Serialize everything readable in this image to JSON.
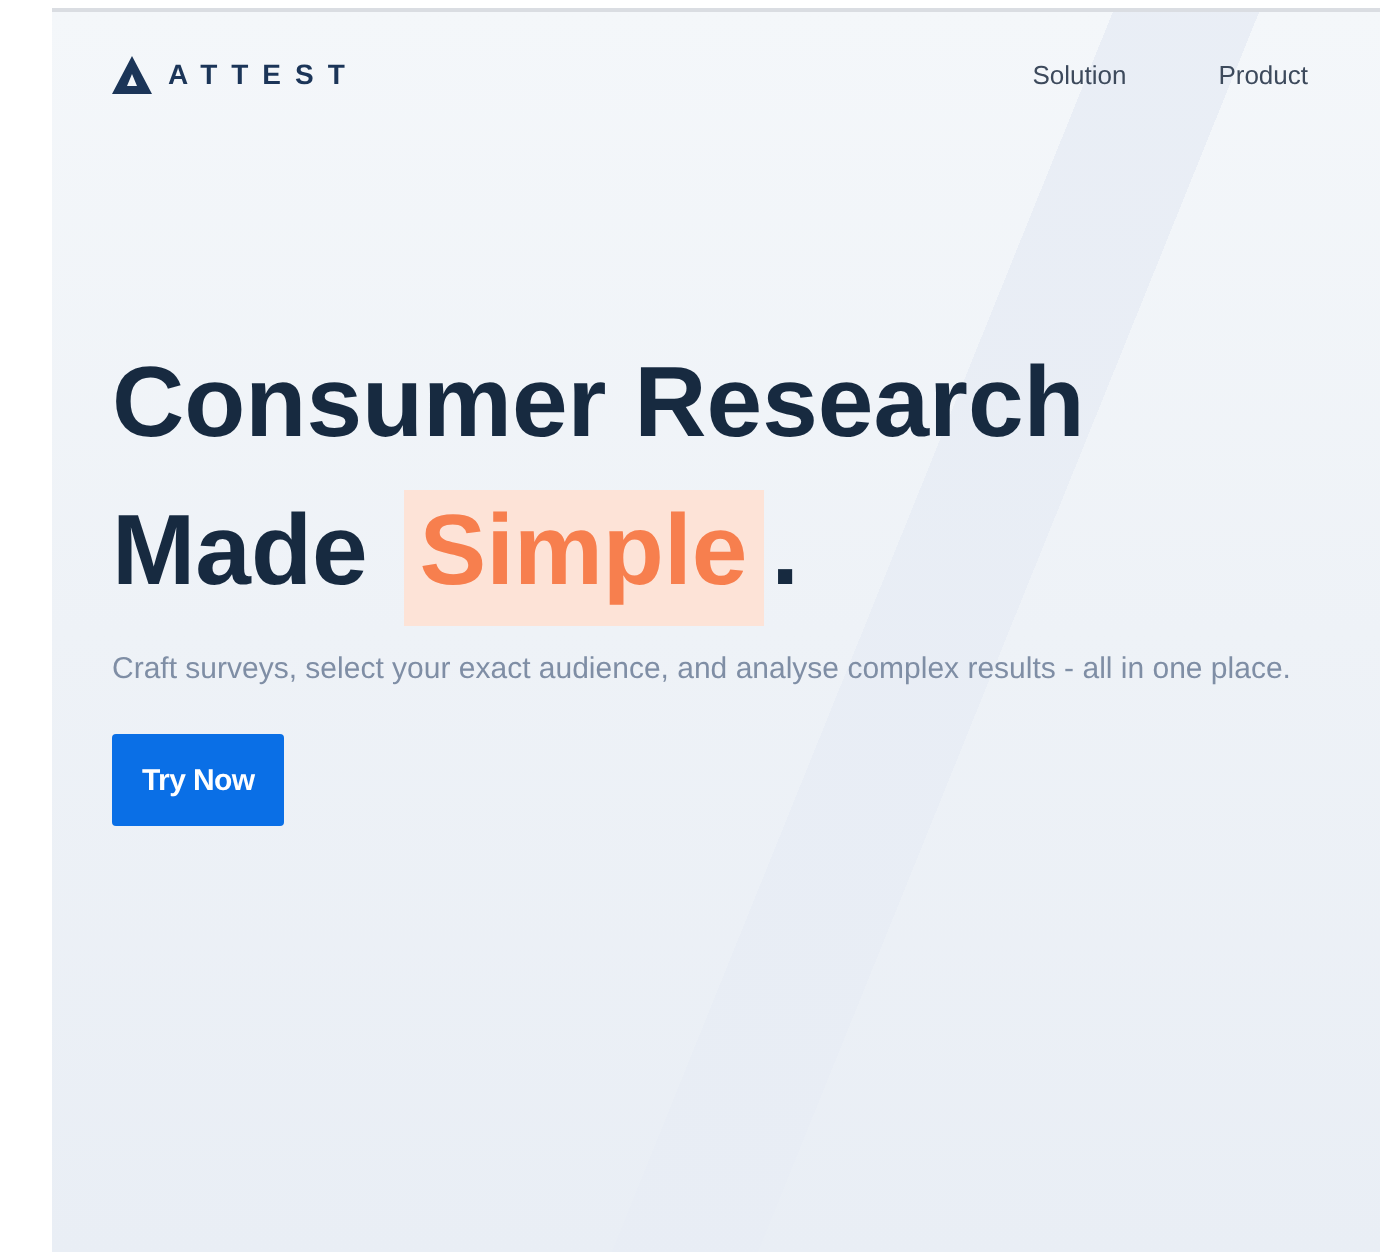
{
  "header": {
    "logo_text": "ATTEST",
    "nav": [
      "Solution",
      "Product"
    ]
  },
  "hero": {
    "headline_line_1": "Consumer Research",
    "headline_line_2": {
      "before": "Made",
      "highlight": "Simple",
      "after": "."
    },
    "subtitle": "Craft surveys, select your exact audience, and analyse complex results - all in one place.",
    "button": "Try Now"
  }
}
